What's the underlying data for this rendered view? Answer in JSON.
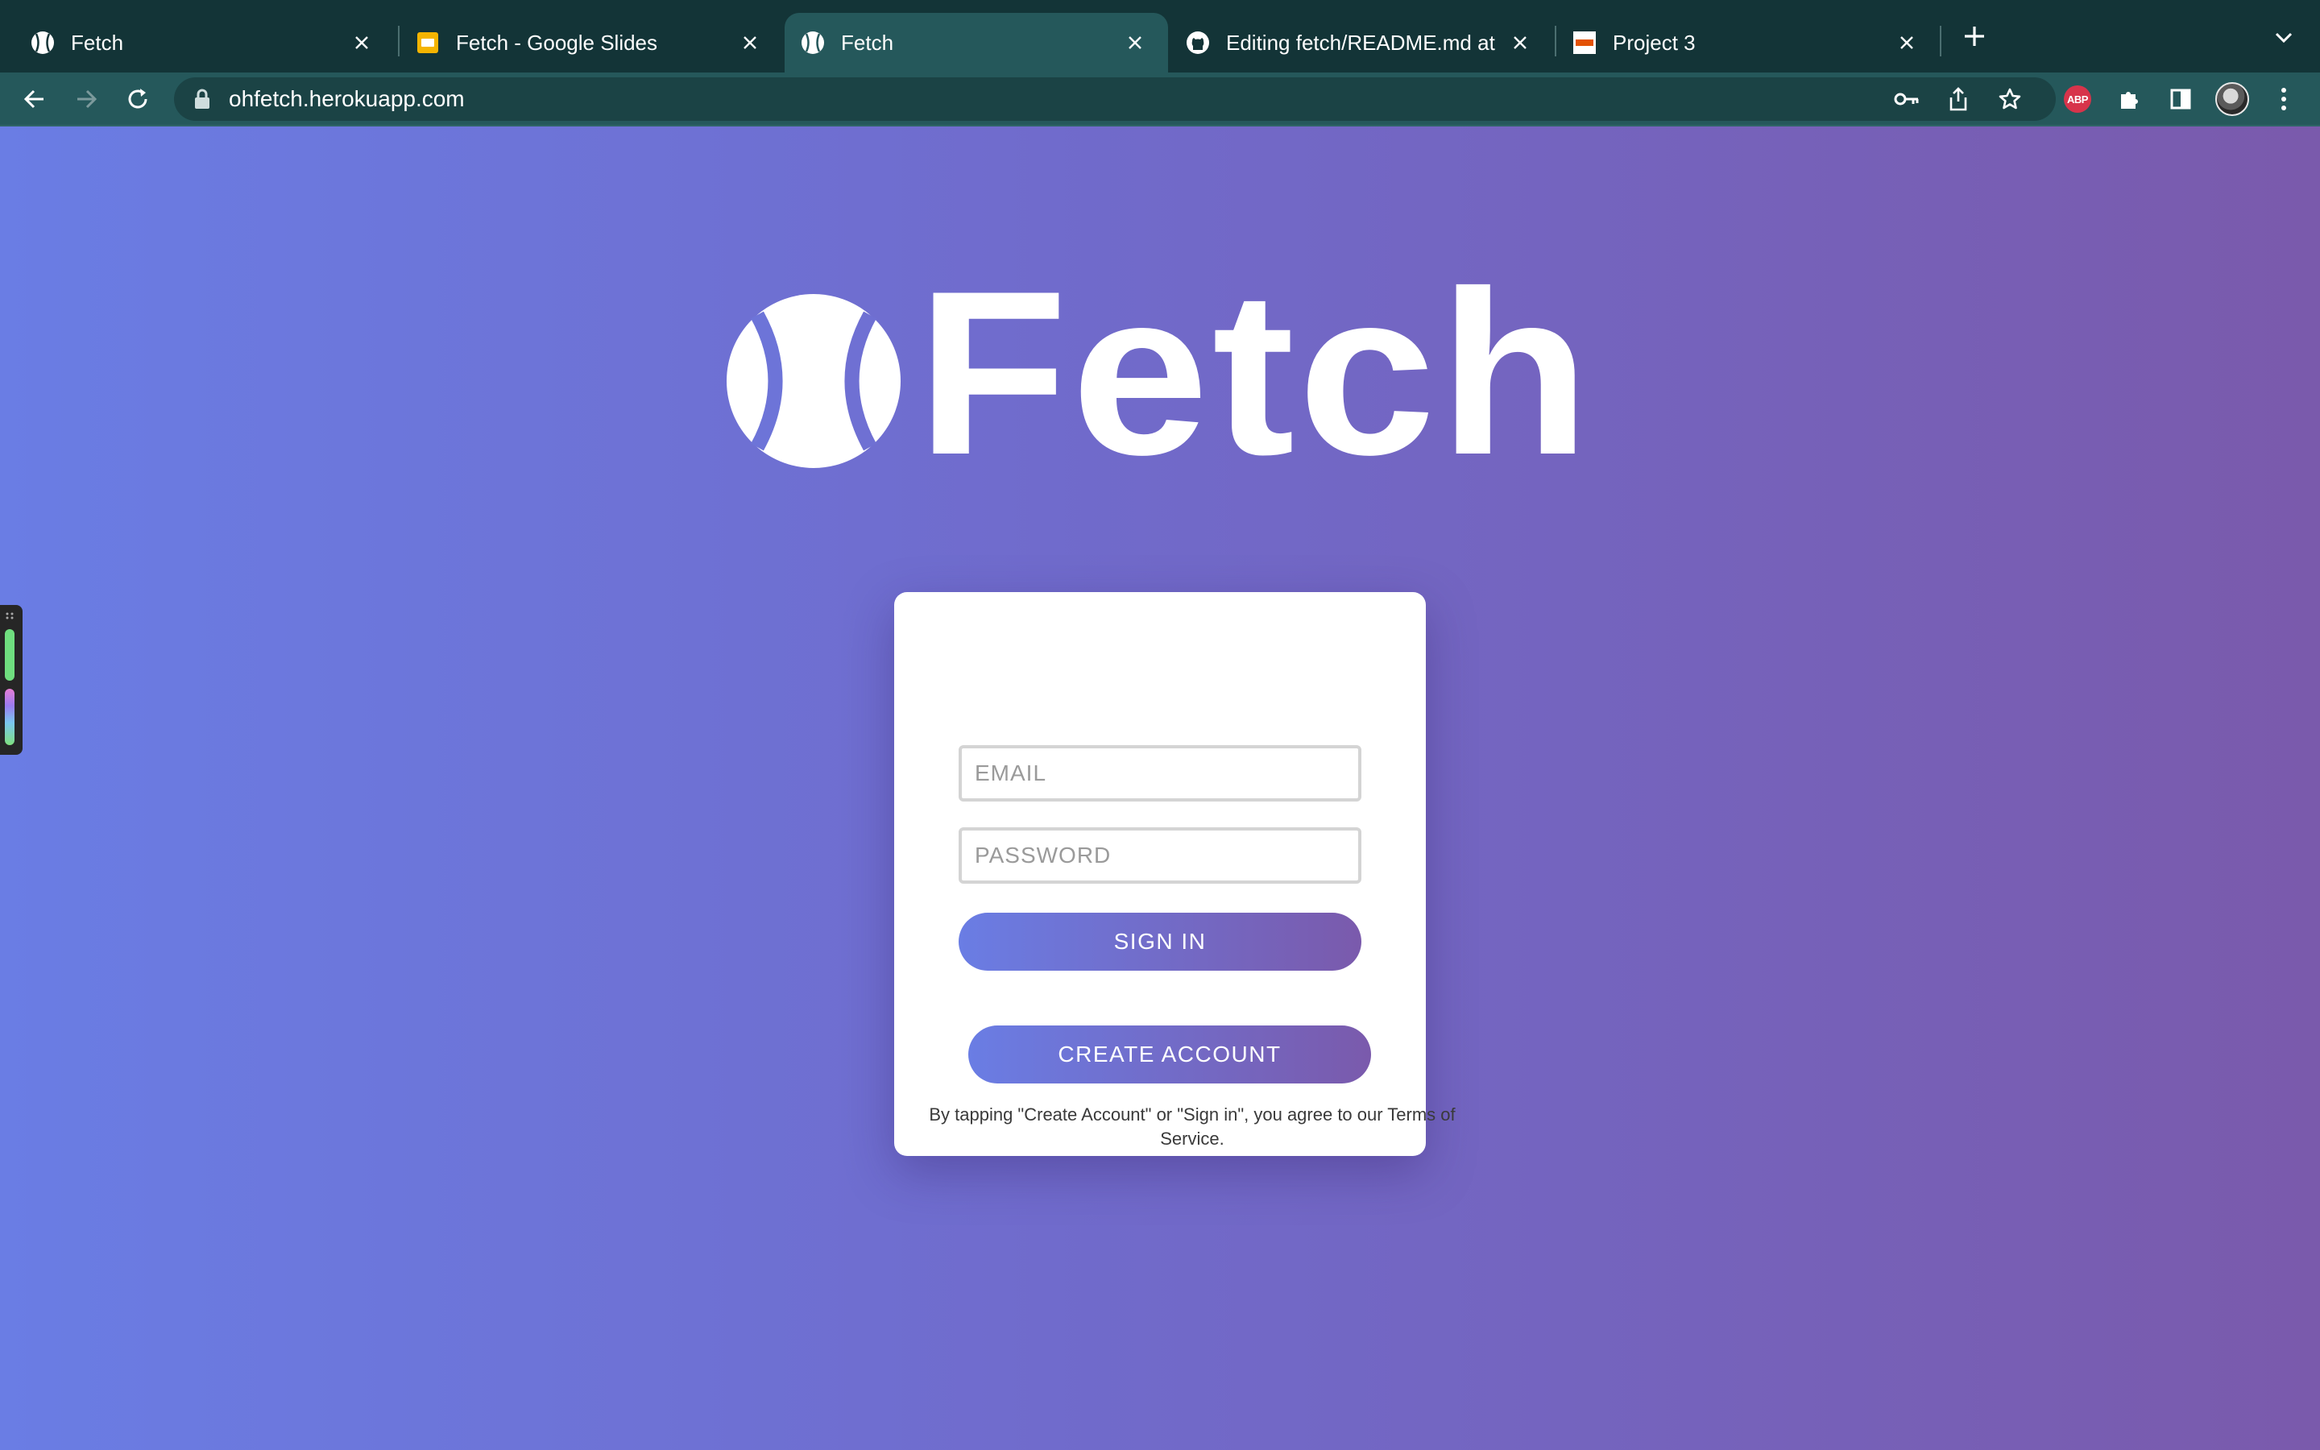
{
  "browser": {
    "tabs": [
      {
        "title": "Fetch",
        "favicon": "baseball-icon",
        "active": false
      },
      {
        "title": "Fetch - Google Slides",
        "favicon": "slides-icon",
        "active": false
      },
      {
        "title": "Fetch",
        "favicon": "baseball-icon",
        "active": true
      },
      {
        "title": "Editing fetch/README.md at m",
        "favicon": "github-icon",
        "active": false
      },
      {
        "title": "Project 3",
        "favicon": "utsa-icon",
        "active": false
      }
    ],
    "url": "ohfetch.herokuapp.com",
    "extension_abp_label": "ABP"
  },
  "page": {
    "logo_text": "Fetch",
    "email_placeholder": "EMAIL",
    "password_placeholder": "PASSWORD",
    "sign_in_label": "SIGN IN",
    "create_account_label": "CREATE ACCOUNT",
    "terms_text": "By tapping \"Create Account\" or \"Sign in\", you agree to our Terms of Service."
  },
  "colors": {
    "gradient_start": "#6a7de4",
    "gradient_end": "#7a5aac",
    "tabstrip": "#133437",
    "toolbar": "#25585b"
  }
}
